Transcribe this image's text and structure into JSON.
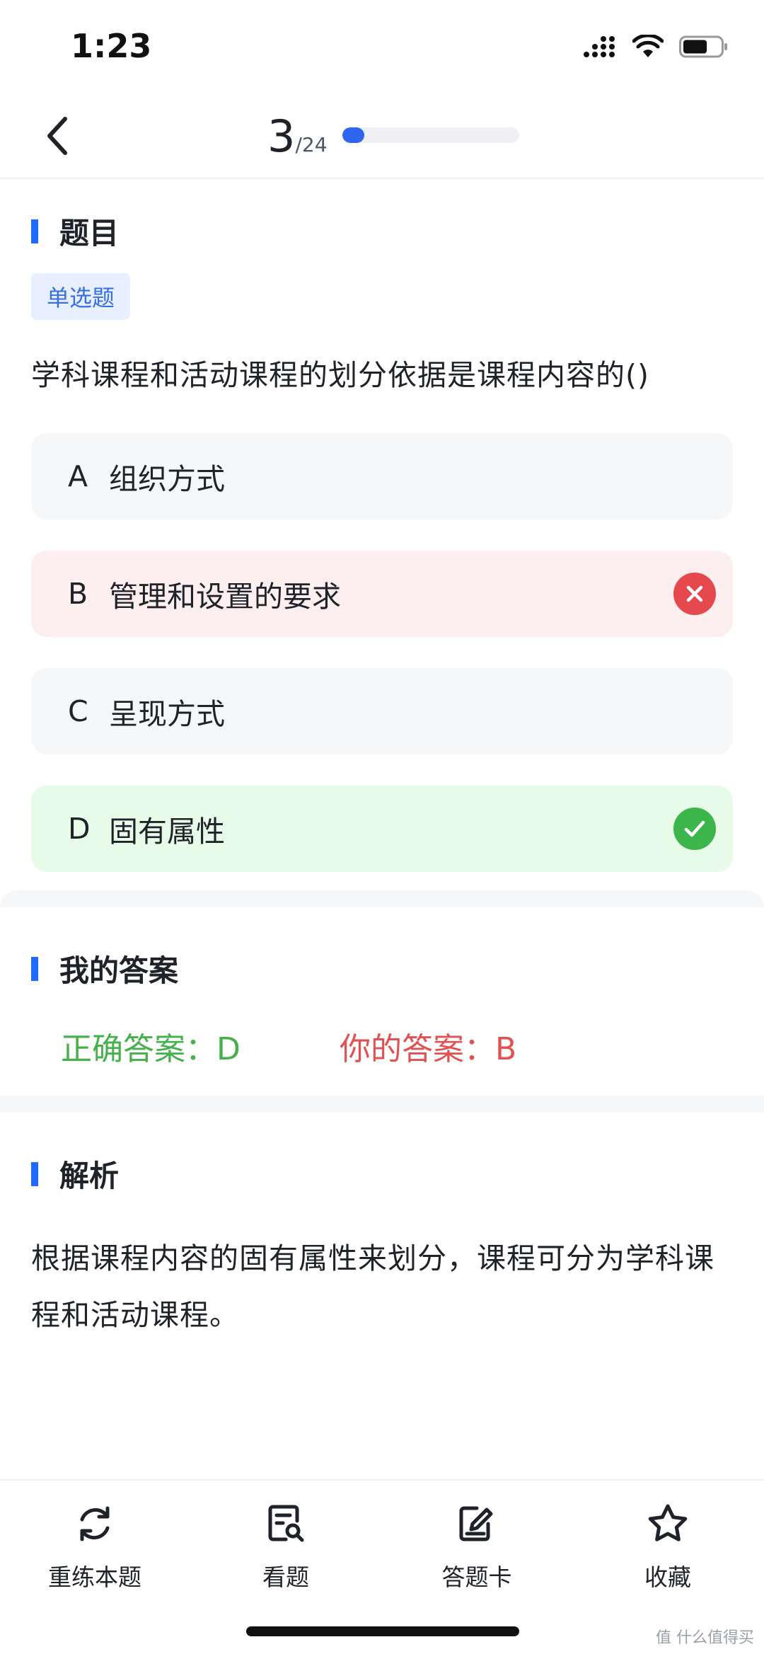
{
  "status": {
    "time": "1:23",
    "signal_icon": "cellular-signal-icon",
    "wifi_icon": "wifi-icon",
    "battery_icon": "battery-icon",
    "battery_level": 0.65
  },
  "nav": {
    "back_icon": "chevron-left-icon",
    "current": "3",
    "total": "/24",
    "progress_fraction": 0.125,
    "accent_color": "#2f66f0"
  },
  "question": {
    "section_title": "题目",
    "type_label": "单选题",
    "text": "学科课程和活动课程的划分依据是课程内容的()",
    "options": [
      {
        "letter": "A",
        "text": "组织方式",
        "state": "normal"
      },
      {
        "letter": "B",
        "text": "管理和设置的要求",
        "state": "wrong"
      },
      {
        "letter": "C",
        "text": "呈现方式",
        "state": "normal"
      },
      {
        "letter": "D",
        "text": "固有属性",
        "state": "right"
      }
    ]
  },
  "my_answer": {
    "section_title": "我的答案",
    "correct_label": "正确答案：",
    "correct_value": "D",
    "yours_label": "你的答案：",
    "yours_value": "B",
    "correct_color": "#46b04b",
    "wrong_color": "#e05252"
  },
  "analysis": {
    "section_title": "解析",
    "text": "根据课程内容的固有属性来划分，课程可分为学科课程和活动课程。"
  },
  "bottom_bar": {
    "items": [
      {
        "label": "重练本题",
        "icon": "refresh-icon"
      },
      {
        "label": "看题",
        "icon": "document-search-icon"
      },
      {
        "label": "答题卡",
        "icon": "answer-sheet-icon"
      },
      {
        "label": "收藏",
        "icon": "star-icon"
      }
    ]
  },
  "watermark": "值 什么值得买"
}
